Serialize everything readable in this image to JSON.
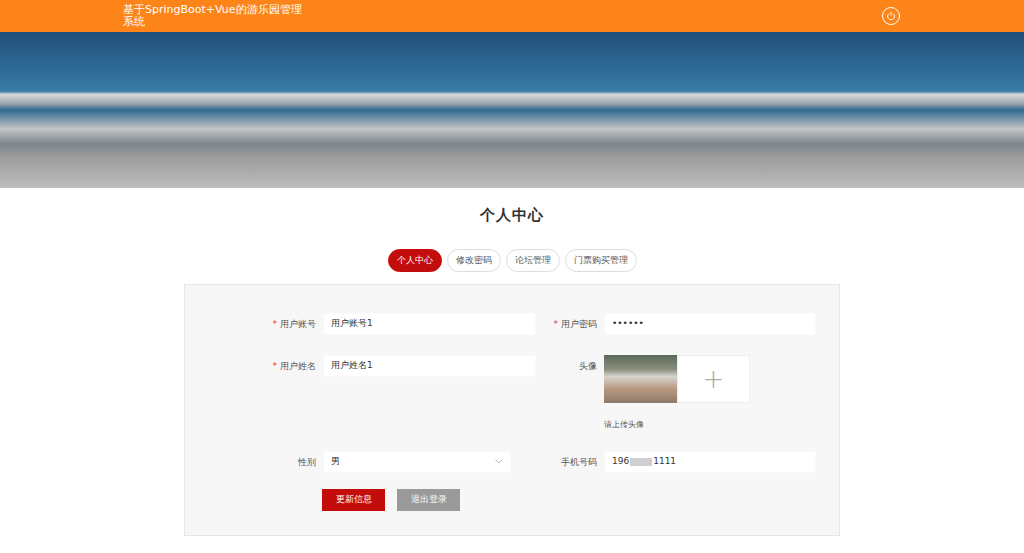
{
  "header": {
    "title": "基于SpringBoot+Vue的游乐园管理系统"
  },
  "page_title": "个人中心",
  "tabs": [
    {
      "label": "个人中心",
      "selected": true
    },
    {
      "label": "修改密码",
      "selected": false
    },
    {
      "label": "论坛管理",
      "selected": false
    },
    {
      "label": "门票购买管理",
      "selected": false
    }
  ],
  "form": {
    "required_mark": "*",
    "fields": [
      {
        "label": "用户账号",
        "required": true,
        "kind": "text",
        "value": "用户账号1"
      },
      {
        "label": "用户密码",
        "required": true,
        "kind": "text",
        "value": "••••••"
      },
      {
        "label": "用户姓名",
        "required": true,
        "kind": "text",
        "value": "用户姓名1"
      },
      {
        "label": "头像",
        "required": false,
        "kind": "upload",
        "plus": "+",
        "hint": "请上传头像"
      },
      {
        "label": "性别",
        "required": false,
        "kind": "select",
        "value": "男"
      },
      {
        "label": "手机号码",
        "required": false,
        "kind": "masked",
        "prefix": "196",
        "suffix": "1111"
      }
    ]
  },
  "buttons": [
    {
      "label": "更新信息",
      "kind": "primary"
    },
    {
      "label": "退出登录",
      "kind": "secondary"
    }
  ]
}
